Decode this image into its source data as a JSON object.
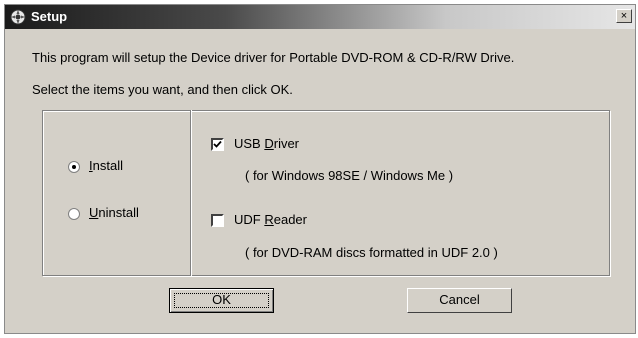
{
  "window": {
    "title": "Setup",
    "close_symbol": "×"
  },
  "description": "This program will setup the Device driver for Portable DVD-ROM & CD-R/RW Drive.",
  "instruction": "Select the items you want, and then click OK.",
  "mode": {
    "install": {
      "mnemonic": "I",
      "rest": "nstall",
      "selected": true
    },
    "uninstall": {
      "mnemonic": "U",
      "rest": "ninstall",
      "selected": false
    }
  },
  "components": {
    "usb": {
      "prefix": "USB ",
      "mnemonic": "D",
      "rest": "river",
      "note": "( for Windows 98SE / Windows Me )",
      "checked": true
    },
    "udf": {
      "prefix": "UDF ",
      "mnemonic": "R",
      "rest": "eader",
      "note": "( for DVD-RAM discs formatted in UDF 2.0 )",
      "checked": false
    }
  },
  "buttons": {
    "ok": "OK",
    "cancel": "Cancel"
  }
}
